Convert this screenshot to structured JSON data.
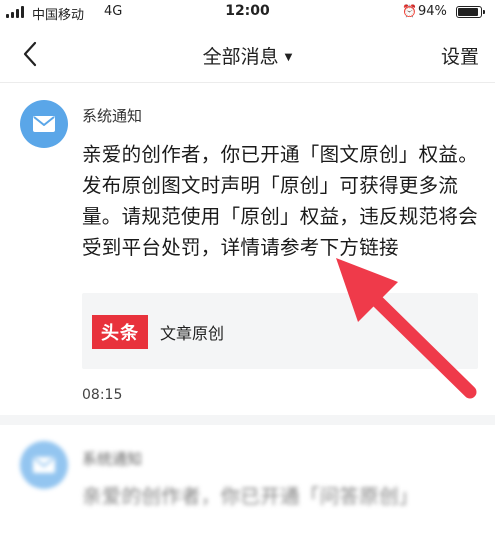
{
  "status_bar": {
    "carrier": "中国移动",
    "network": "4G",
    "time": "12:00",
    "battery": "94%",
    "battery_level": 0.94
  },
  "nav": {
    "title": "全部消息",
    "dropdown_icon": "triangle-down-icon",
    "settings_label": "设置",
    "back_icon": "chevron-left-icon"
  },
  "messages": [
    {
      "sender": "系统通知",
      "avatar_icon": "mail-icon",
      "body": "亲爱的创作者，你已开通「图文原创」权益。发布原创图文时声明「原创」可获得更多流量。请规范使用「原创」权益，违反规范将会受到平台处罚，详情请参考下方链接",
      "card": {
        "logo_text": "头条",
        "title": "文章原创"
      },
      "time": "08:15"
    },
    {
      "sender": "系统通知",
      "avatar_icon": "mail-icon",
      "body": "亲爱的创作者，你已开通「问答原创」"
    }
  ],
  "colors": {
    "avatar_blue": "#5aa6e8",
    "toutiao_red": "#e8323c",
    "annotation_arrow": "#ef3a4a"
  }
}
